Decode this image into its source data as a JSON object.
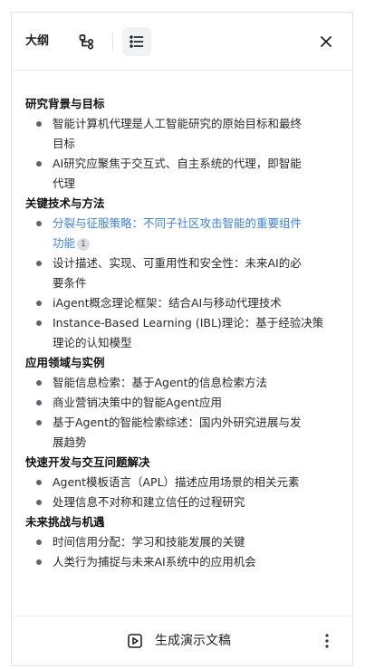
{
  "header": {
    "title": "大纲",
    "mindmap_icon": "mindmap-icon",
    "list_icon": "list-icon",
    "close_icon": "close-icon"
  },
  "outline": [
    {
      "heading": "研究背景与目标",
      "items": [
        {
          "lines": [
            "智能计算机代理是人工智能研究的原始目标和最终",
            "目标"
          ]
        },
        {
          "lines": [
            "AI研究应聚焦于交互式、自主系统的代理，即智能",
            "代理"
          ]
        }
      ]
    },
    {
      "heading": "关键技术与方法",
      "items": [
        {
          "lines": [
            "分裂与征服策略：不同子社区攻击智能的重要组件",
            "功能"
          ],
          "active": true,
          "badge": "1"
        },
        {
          "lines": [
            "设计描述、实现、可重用性和安全性：未来AI的必",
            "要条件"
          ]
        },
        {
          "lines": [
            "iAgent概念理论框架：结合AI与移动代理技术"
          ]
        },
        {
          "lines": [
            "Instance-Based Learning (IBL)理论：基于经验决策",
            "理论的认知模型"
          ]
        }
      ]
    },
    {
      "heading": "应用领域与实例",
      "items": [
        {
          "lines": [
            "智能信息检索：基于Agent的信息检索方法"
          ]
        },
        {
          "lines": [
            "商业营销决策中的智能Agent应用"
          ]
        },
        {
          "lines": [
            "基于Agent的智能检索综述：国内外研究进展与发",
            "展趋势"
          ]
        }
      ]
    },
    {
      "heading": "快速开发与交互问题解决",
      "items": [
        {
          "lines": [
            "Agent模板语言（APL）描述应用场景的相关元素"
          ]
        },
        {
          "lines": [
            "处理信息不对称和建立信任的过程研究"
          ]
        }
      ]
    },
    {
      "heading": "未来挑战与机遇",
      "items": [
        {
          "lines": [
            "时间信用分配：学习和技能发展的关键"
          ]
        },
        {
          "lines": [
            "人类行为捕捉与未来AI系统中的应用机会"
          ]
        }
      ]
    }
  ],
  "footer": {
    "generate_label": "生成演示文稿",
    "generate_icon": "play-slide-icon",
    "more_icon": "more-vertical-icon"
  },
  "colors": {
    "accent": "#3d82e0",
    "bullet": "#5c6470",
    "badge_bg": "#d9dce1"
  }
}
